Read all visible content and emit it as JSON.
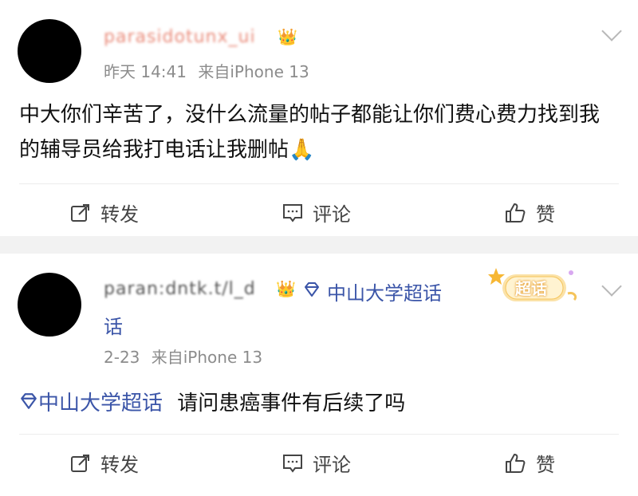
{
  "post1": {
    "username": "parasidotunx_ui",
    "time": "昨天 14:41",
    "source": "来自iPhone 13",
    "content": "中大你们辛苦了，没什么流量的帖子都能让你们费心费力找到我的辅导员给我打电话让我删帖",
    "emoji": "🙏",
    "actions": {
      "repost": "转发",
      "comment": "评论",
      "like": "赞"
    }
  },
  "post2": {
    "username": "paran:dntk.t/l_d",
    "topic_tag": "中山大学超话",
    "badge": "超话",
    "time": "2-23",
    "source": "来自iPhone 13",
    "topic_link": "中山大学超话",
    "content": "请问患癌事件有后续了吗",
    "actions": {
      "repost": "转发",
      "comment": "评论",
      "like": "赞"
    }
  },
  "colors": {
    "topic": "#3b55a8",
    "meta": "#8c8c8c",
    "divider": "#f2f2f2"
  },
  "icons": [
    "crown-icon",
    "chevron-down-icon",
    "repost-icon",
    "comment-icon",
    "like-icon",
    "diamond-icon",
    "chaohua-badge-icon"
  ]
}
